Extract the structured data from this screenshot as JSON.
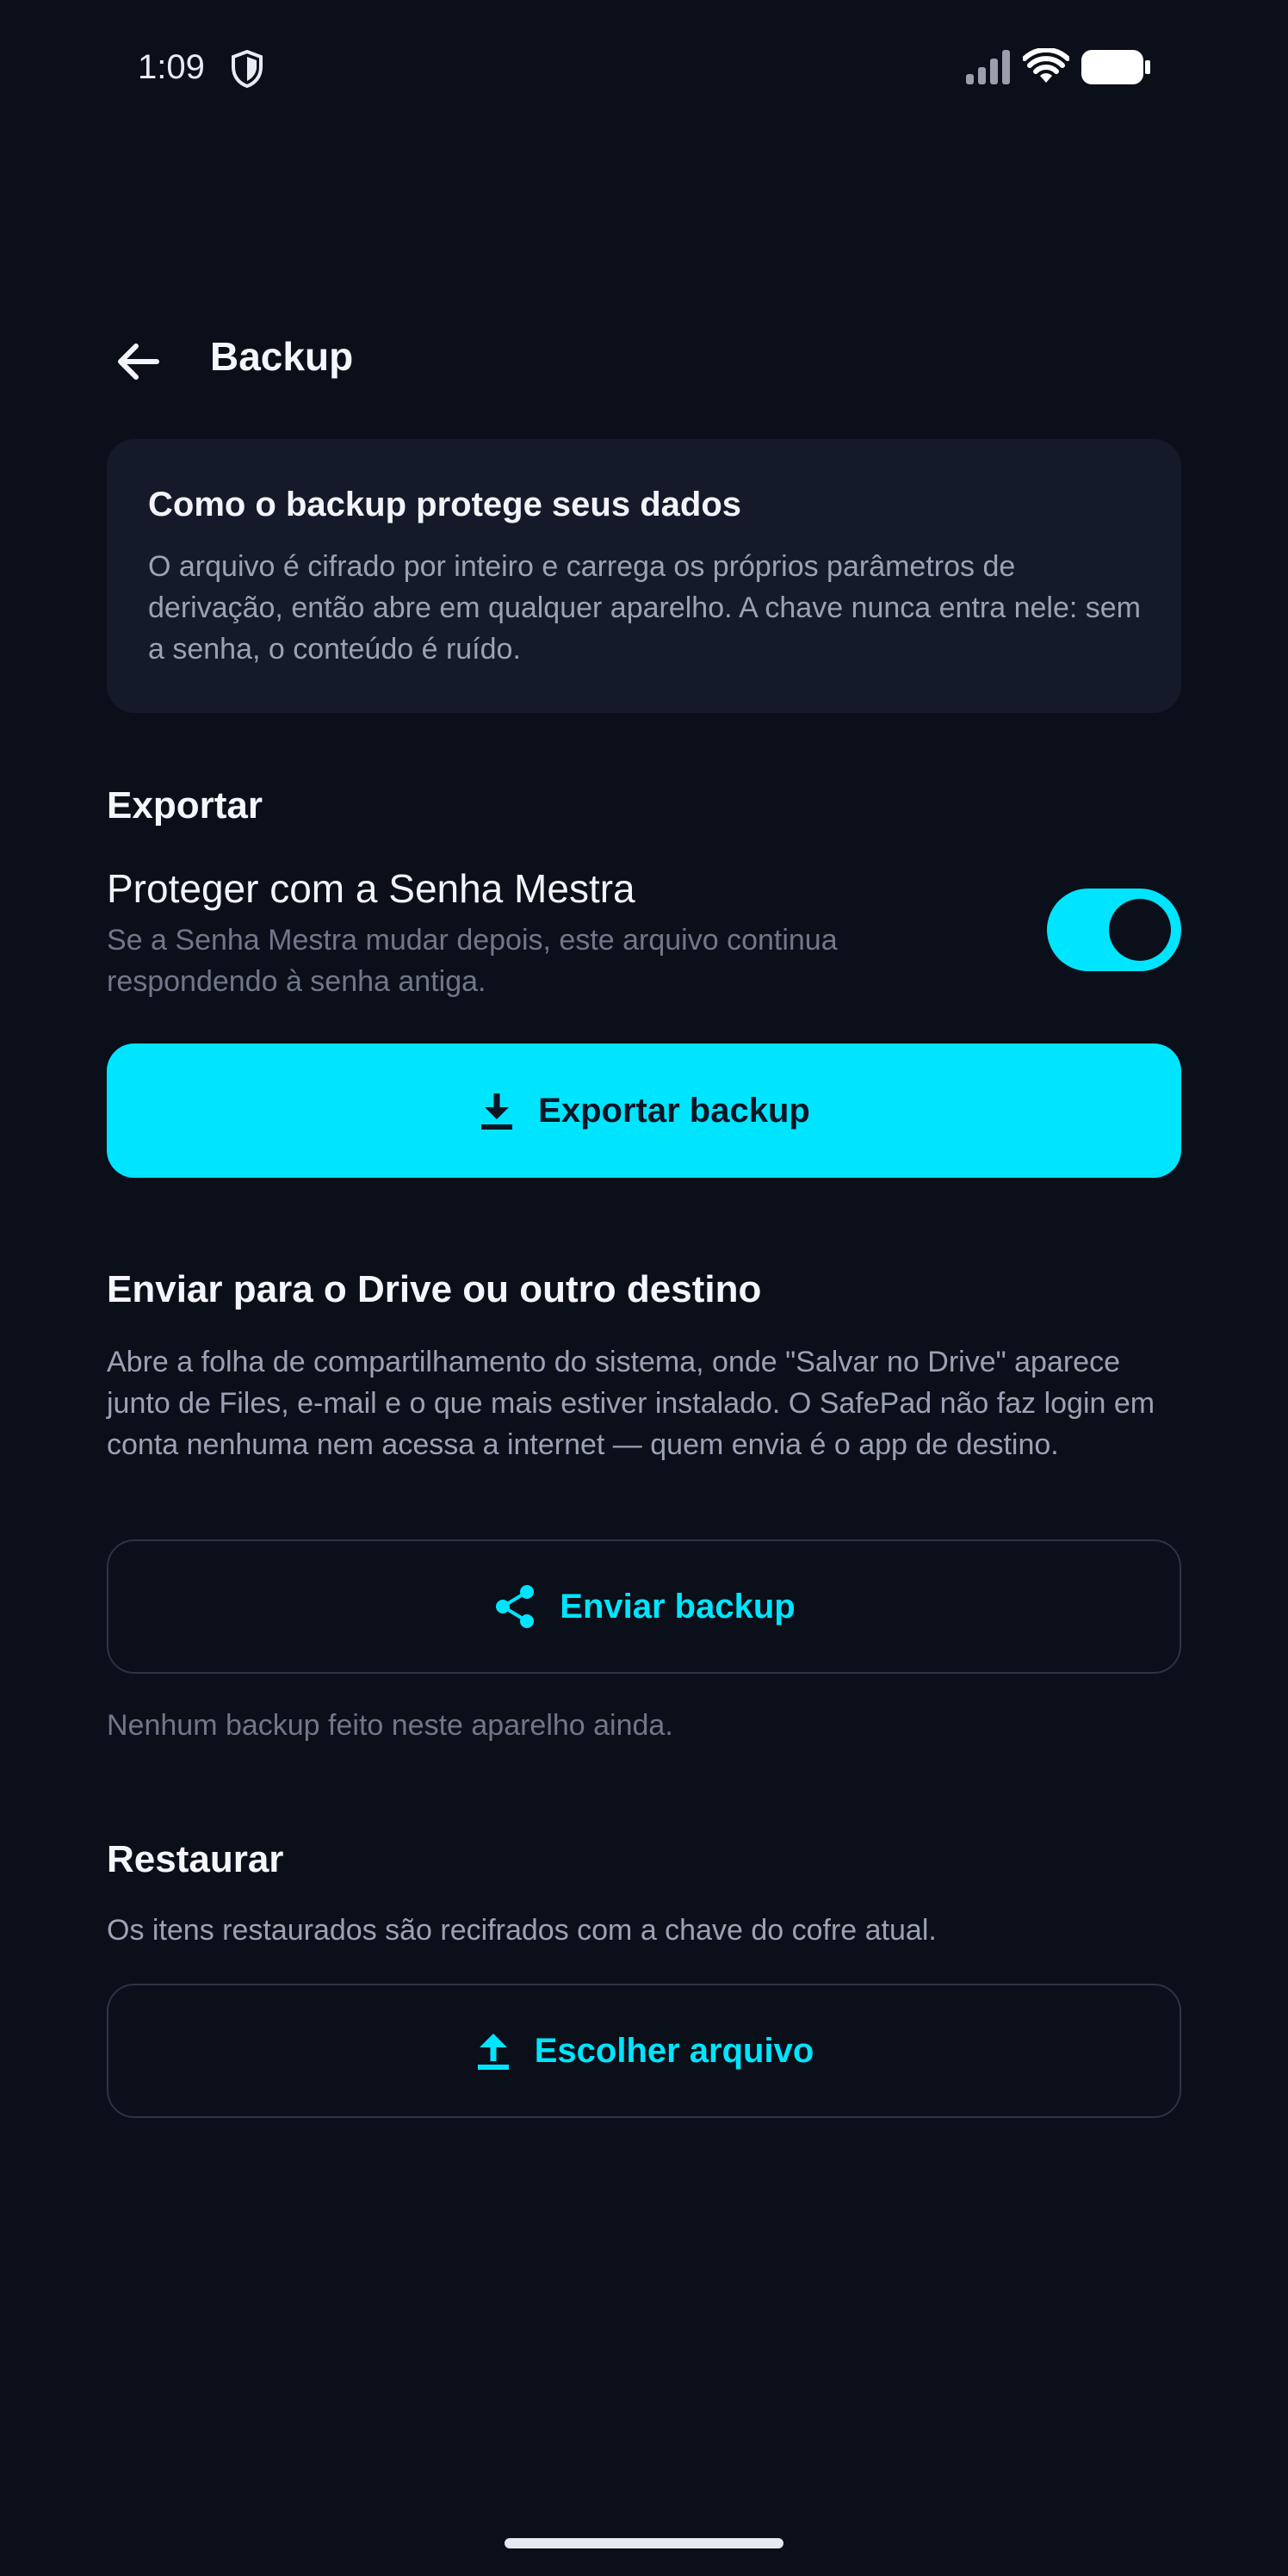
{
  "status_bar": {
    "time": "1:09"
  },
  "app_bar": {
    "title": "Backup"
  },
  "info_card": {
    "title": "Como o backup protege seus dados",
    "body": "O arquivo é cifrado por inteiro e carrega os próprios parâmetros de derivação, então abre em qualquer aparelho. A chave nunca entra nele: sem a senha, o conteúdo é ruído."
  },
  "export": {
    "section_title": "Exportar",
    "setting_title": "Proteger com a Senha Mestra",
    "setting_subtitle": "Se a Senha Mestra mudar depois, este arquivo continua respondendo à senha antiga.",
    "toggle_on": true,
    "button_label": "Exportar backup"
  },
  "send": {
    "section_title": "Enviar para o Drive ou outro destino",
    "body": "Abre a folha de compartilhamento do sistema, onde \"Salvar no Drive\" aparece junto de Files, e-mail e o que mais estiver instalado. O SafePad não faz login em conta nenhuma nem acessa a internet — quem envia é o app de destino.",
    "button_label": "Enviar backup",
    "status_text": "Nenhum backup feito neste aparelho ainda."
  },
  "restore": {
    "section_title": "Restaurar",
    "body": "Os itens restaurados são recifrados com a chave do cofre atual.",
    "button_label": "Escolher arquivo"
  },
  "colors": {
    "background": "#0b0f19",
    "card": "#141a29",
    "accent": "#00e5ff",
    "muted_text": "#9aa2b4"
  },
  "icons": [
    "shield-icon",
    "signal-icon",
    "wifi-icon",
    "battery-icon",
    "back-arrow-icon",
    "download-icon",
    "share-icon",
    "upload-icon"
  ]
}
